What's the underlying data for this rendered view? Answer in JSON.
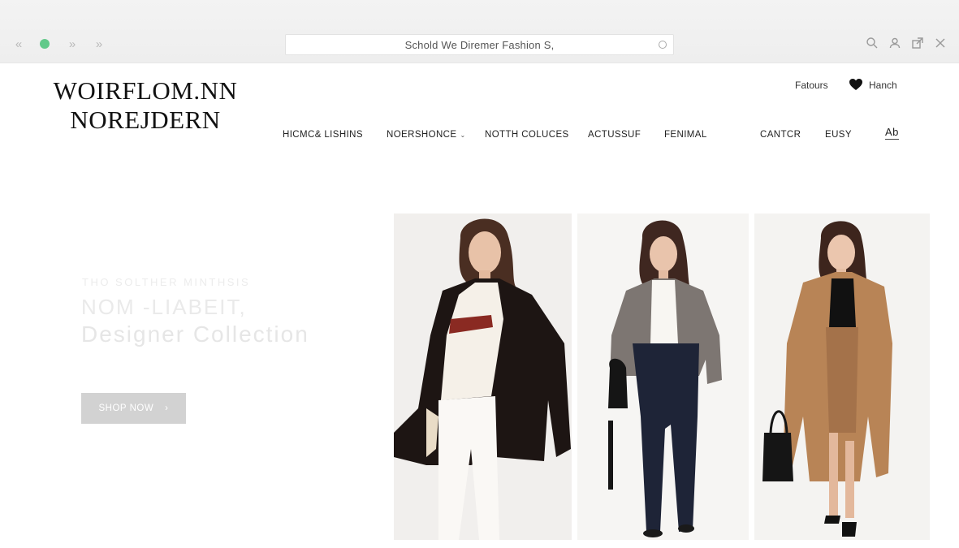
{
  "browser": {
    "address_text": "Schold We Diremer Fashion S,",
    "accent_dot_color": "#62c98a",
    "icons": [
      "back-icon",
      "forward-icon",
      "forward-alt-icon",
      "search-icon",
      "user-icon",
      "extension-icon",
      "close-icon"
    ]
  },
  "site": {
    "logo_line1": "WOIRFLOM.NN",
    "logo_line2": "NOREJDERN",
    "util": {
      "favours": "Fatours",
      "hanch": "Hanch"
    },
    "nav": [
      {
        "label": "HICMC& LISHINS"
      },
      {
        "label": "NOERSHONCE",
        "has_dropdown": true
      },
      {
        "label": "NOTTH COLUCES"
      },
      {
        "label": "ACTUSSUF"
      },
      {
        "label": "FENIMAL"
      },
      {
        "label": "CANTCR"
      },
      {
        "label": "EUSY"
      },
      {
        "label": "Ab"
      }
    ]
  },
  "hero": {
    "eyebrow": "THO SOLTHER MINTHSIS",
    "title": "NOM -LIABEIT,",
    "subtitle": "Designer Collection",
    "cta": "SHOP NOW",
    "cta_icon": "chevron-right-icon"
  },
  "photos": [
    {
      "name": "model-black-coat"
    },
    {
      "name": "model-grey-blazer"
    },
    {
      "name": "model-camel-coat"
    }
  ]
}
